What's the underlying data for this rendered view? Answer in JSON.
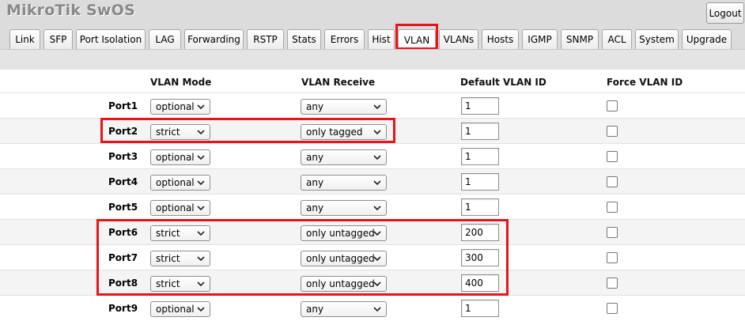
{
  "app": {
    "title": "MikroTik SwOS",
    "logout_label": "Logout"
  },
  "tabs": [
    {
      "label": "Link"
    },
    {
      "label": "SFP"
    },
    {
      "label": "Port Isolation"
    },
    {
      "label": "LAG"
    },
    {
      "label": "Forwarding"
    },
    {
      "label": "RSTP"
    },
    {
      "label": "Stats"
    },
    {
      "label": "Errors"
    },
    {
      "label": "Hist"
    },
    {
      "label": "VLAN",
      "active": true
    },
    {
      "label": "VLANs"
    },
    {
      "label": "Hosts"
    },
    {
      "label": "IGMP"
    },
    {
      "label": "SNMP"
    },
    {
      "label": "ACL"
    },
    {
      "label": "System"
    },
    {
      "label": "Upgrade"
    }
  ],
  "table": {
    "headers": {
      "vlan_mode": "VLAN Mode",
      "vlan_receive": "VLAN Receive",
      "default_vlan_id": "Default VLAN ID",
      "force_vlan_id": "Force VLAN ID"
    },
    "rows": [
      {
        "port": "Port1",
        "vlan_mode": "optional",
        "vlan_receive": "any",
        "default_vlan_id": "1",
        "force_vlan_id": false
      },
      {
        "port": "Port2",
        "vlan_mode": "strict",
        "vlan_receive": "only tagged",
        "default_vlan_id": "1",
        "force_vlan_id": false
      },
      {
        "port": "Port3",
        "vlan_mode": "optional",
        "vlan_receive": "any",
        "default_vlan_id": "1",
        "force_vlan_id": false
      },
      {
        "port": "Port4",
        "vlan_mode": "optional",
        "vlan_receive": "any",
        "default_vlan_id": "1",
        "force_vlan_id": false
      },
      {
        "port": "Port5",
        "vlan_mode": "optional",
        "vlan_receive": "any",
        "default_vlan_id": "1",
        "force_vlan_id": false
      },
      {
        "port": "Port6",
        "vlan_mode": "strict",
        "vlan_receive": "only untagged",
        "default_vlan_id": "200",
        "force_vlan_id": false
      },
      {
        "port": "Port7",
        "vlan_mode": "strict",
        "vlan_receive": "only untagged",
        "default_vlan_id": "300",
        "force_vlan_id": false
      },
      {
        "port": "Port8",
        "vlan_mode": "strict",
        "vlan_receive": "only untagged",
        "default_vlan_id": "400",
        "force_vlan_id": false
      },
      {
        "port": "Port9",
        "vlan_mode": "optional",
        "vlan_receive": "any",
        "default_vlan_id": "1",
        "force_vlan_id": false
      }
    ]
  },
  "colors": {
    "highlight": "#e8141a",
    "topbar": "#dcdcdc",
    "title": "#888888"
  },
  "icons": {
    "dropdown": "chevron-down-icon",
    "checkbox": "checkbox-icon"
  }
}
